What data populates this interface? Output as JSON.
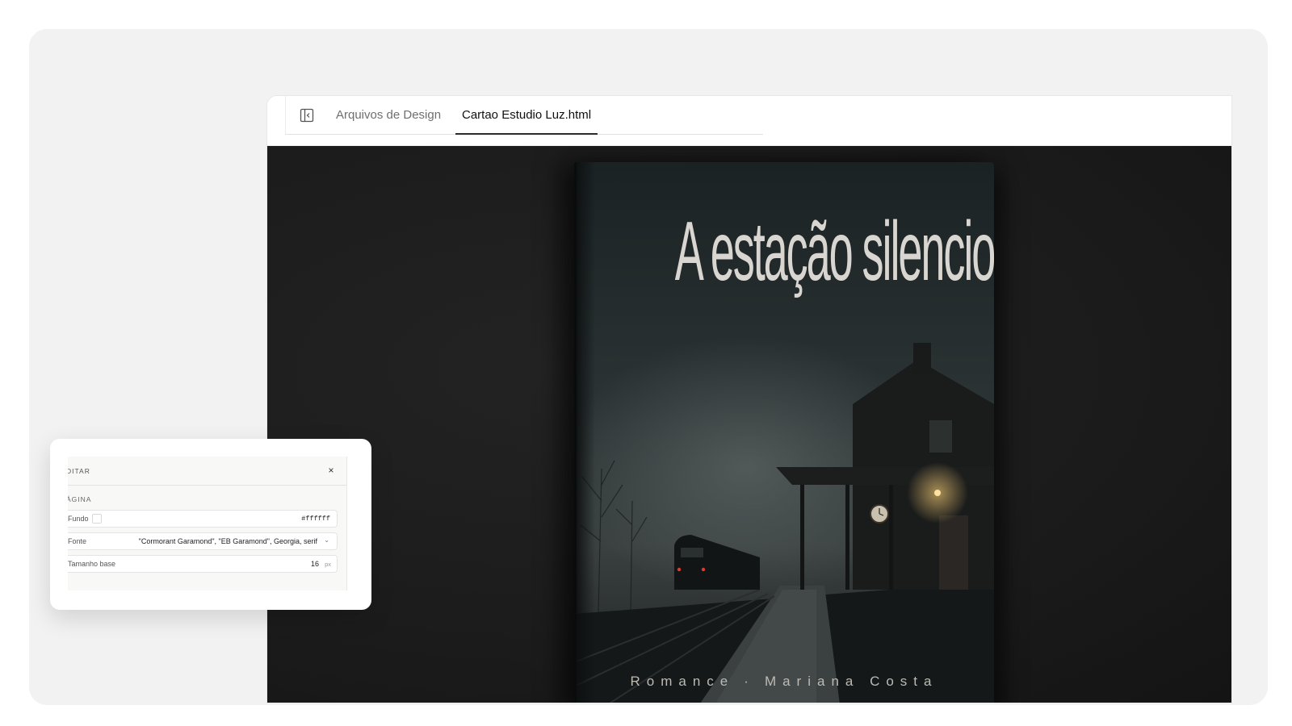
{
  "tabs": [
    {
      "label": "Arquivos de Design"
    },
    {
      "label": "Cartao Estudio Luz.html"
    }
  ],
  "book": {
    "title": "A estação silenciosa",
    "genre": "Romance",
    "separator": "·",
    "author": "Mariana Costa"
  },
  "edit_panel": {
    "title": "DITAR",
    "section": "ÁGINA",
    "background_label": "Fundo",
    "background_value": "#ffffff",
    "font_label": "Fonte",
    "font_value": "\"Cormorant Garamond\", \"EB Garamond\", Georgia, serif",
    "size_label": "Tamanho base",
    "size_value": "16",
    "size_unit": "px",
    "close_glyph": "×",
    "chevron_glyph": "⌄"
  },
  "icons": {
    "panel_toggle": "sidebar-toggle-icon",
    "close": "close-icon",
    "chevron": "chevron-down-icon"
  },
  "colors": {
    "canvas": "#1b1b1b",
    "title_text": "#d9d6d1",
    "active_tab_underline": "#2b2b2b"
  }
}
